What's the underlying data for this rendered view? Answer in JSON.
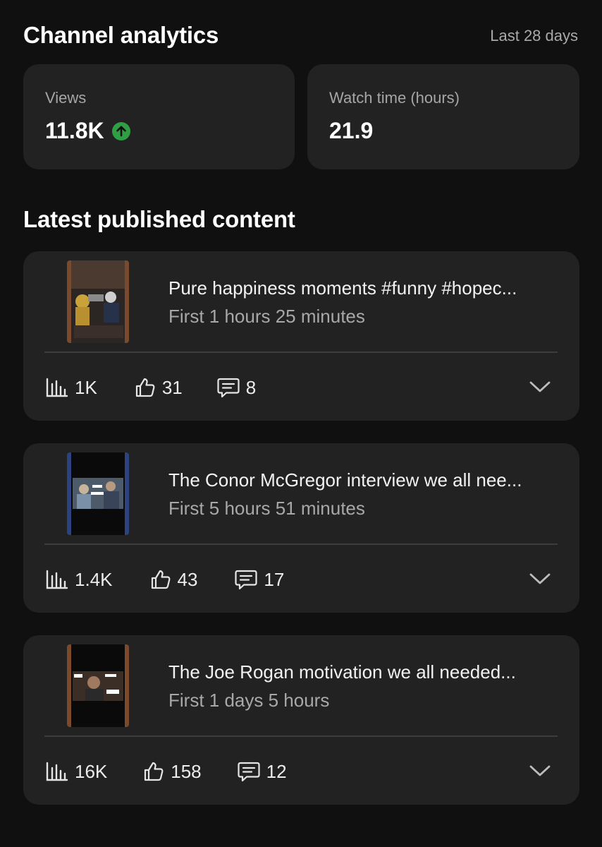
{
  "header": {
    "title": "Channel analytics",
    "range": "Last 28 days"
  },
  "stats": {
    "views": {
      "label": "Views",
      "value": "11.8K",
      "trend_icon": "arrow-up-circle-icon",
      "trend_color": "#2ea043"
    },
    "watch_time": {
      "label": "Watch time (hours)",
      "value": "21.9"
    }
  },
  "latest": {
    "title": "Latest published content",
    "items": [
      {
        "title": "Pure happiness moments #funny #hopec...",
        "subtitle": "First 1 hours 25 minutes",
        "views": "1K",
        "likes": "31",
        "comments": "8",
        "thumb_color": "#7a4a2e"
      },
      {
        "title": "The Conor McGregor interview we all nee...",
        "subtitle": "First 5 hours 51 minutes",
        "views": "1.4K",
        "likes": "43",
        "comments": "17",
        "thumb_color": "#2c4380"
      },
      {
        "title": "The Joe Rogan motivation we all needed...",
        "subtitle": "First 1 days 5 hours",
        "views": "16K",
        "likes": "158",
        "comments": "12",
        "thumb_color": "#7b4a2c"
      }
    ]
  },
  "icons": {
    "views": "bar-chart-icon",
    "likes": "thumbs-up-icon",
    "comments": "comment-icon",
    "expand": "chevron-down-icon"
  }
}
